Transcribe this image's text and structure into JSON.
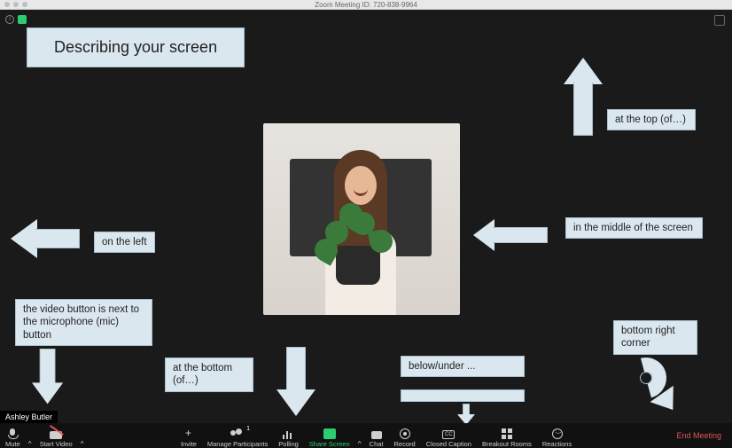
{
  "window": {
    "title": "Zoom Meeting ID: 720-838-9964"
  },
  "participant": {
    "name": "Ashley Butler"
  },
  "toolbar": {
    "mute": {
      "label": "Mute"
    },
    "video": {
      "label": "Start Video"
    },
    "invite": {
      "label": "Invite"
    },
    "participants": {
      "label": "Manage Participants",
      "count": "1"
    },
    "polling": {
      "label": "Polling"
    },
    "share": {
      "label": "Share Screen"
    },
    "chat": {
      "label": "Chat"
    },
    "record": {
      "label": "Record"
    },
    "cc": {
      "label": "Closed Caption",
      "badge": "CC"
    },
    "breakout": {
      "label": "Breakout Rooms"
    },
    "reactions": {
      "label": "Reactions"
    },
    "end": {
      "label": "End Meeting"
    }
  },
  "annotations": {
    "title": "Describing your screen",
    "top": "at the top (of…)",
    "left": "on the left",
    "middle": "in the middle of the screen",
    "video_mic": "the video button is next to the microphone (mic) button",
    "bottom": "at the bottom (of…)",
    "below": "below/under ...",
    "bottom_right": "bottom right corner"
  }
}
